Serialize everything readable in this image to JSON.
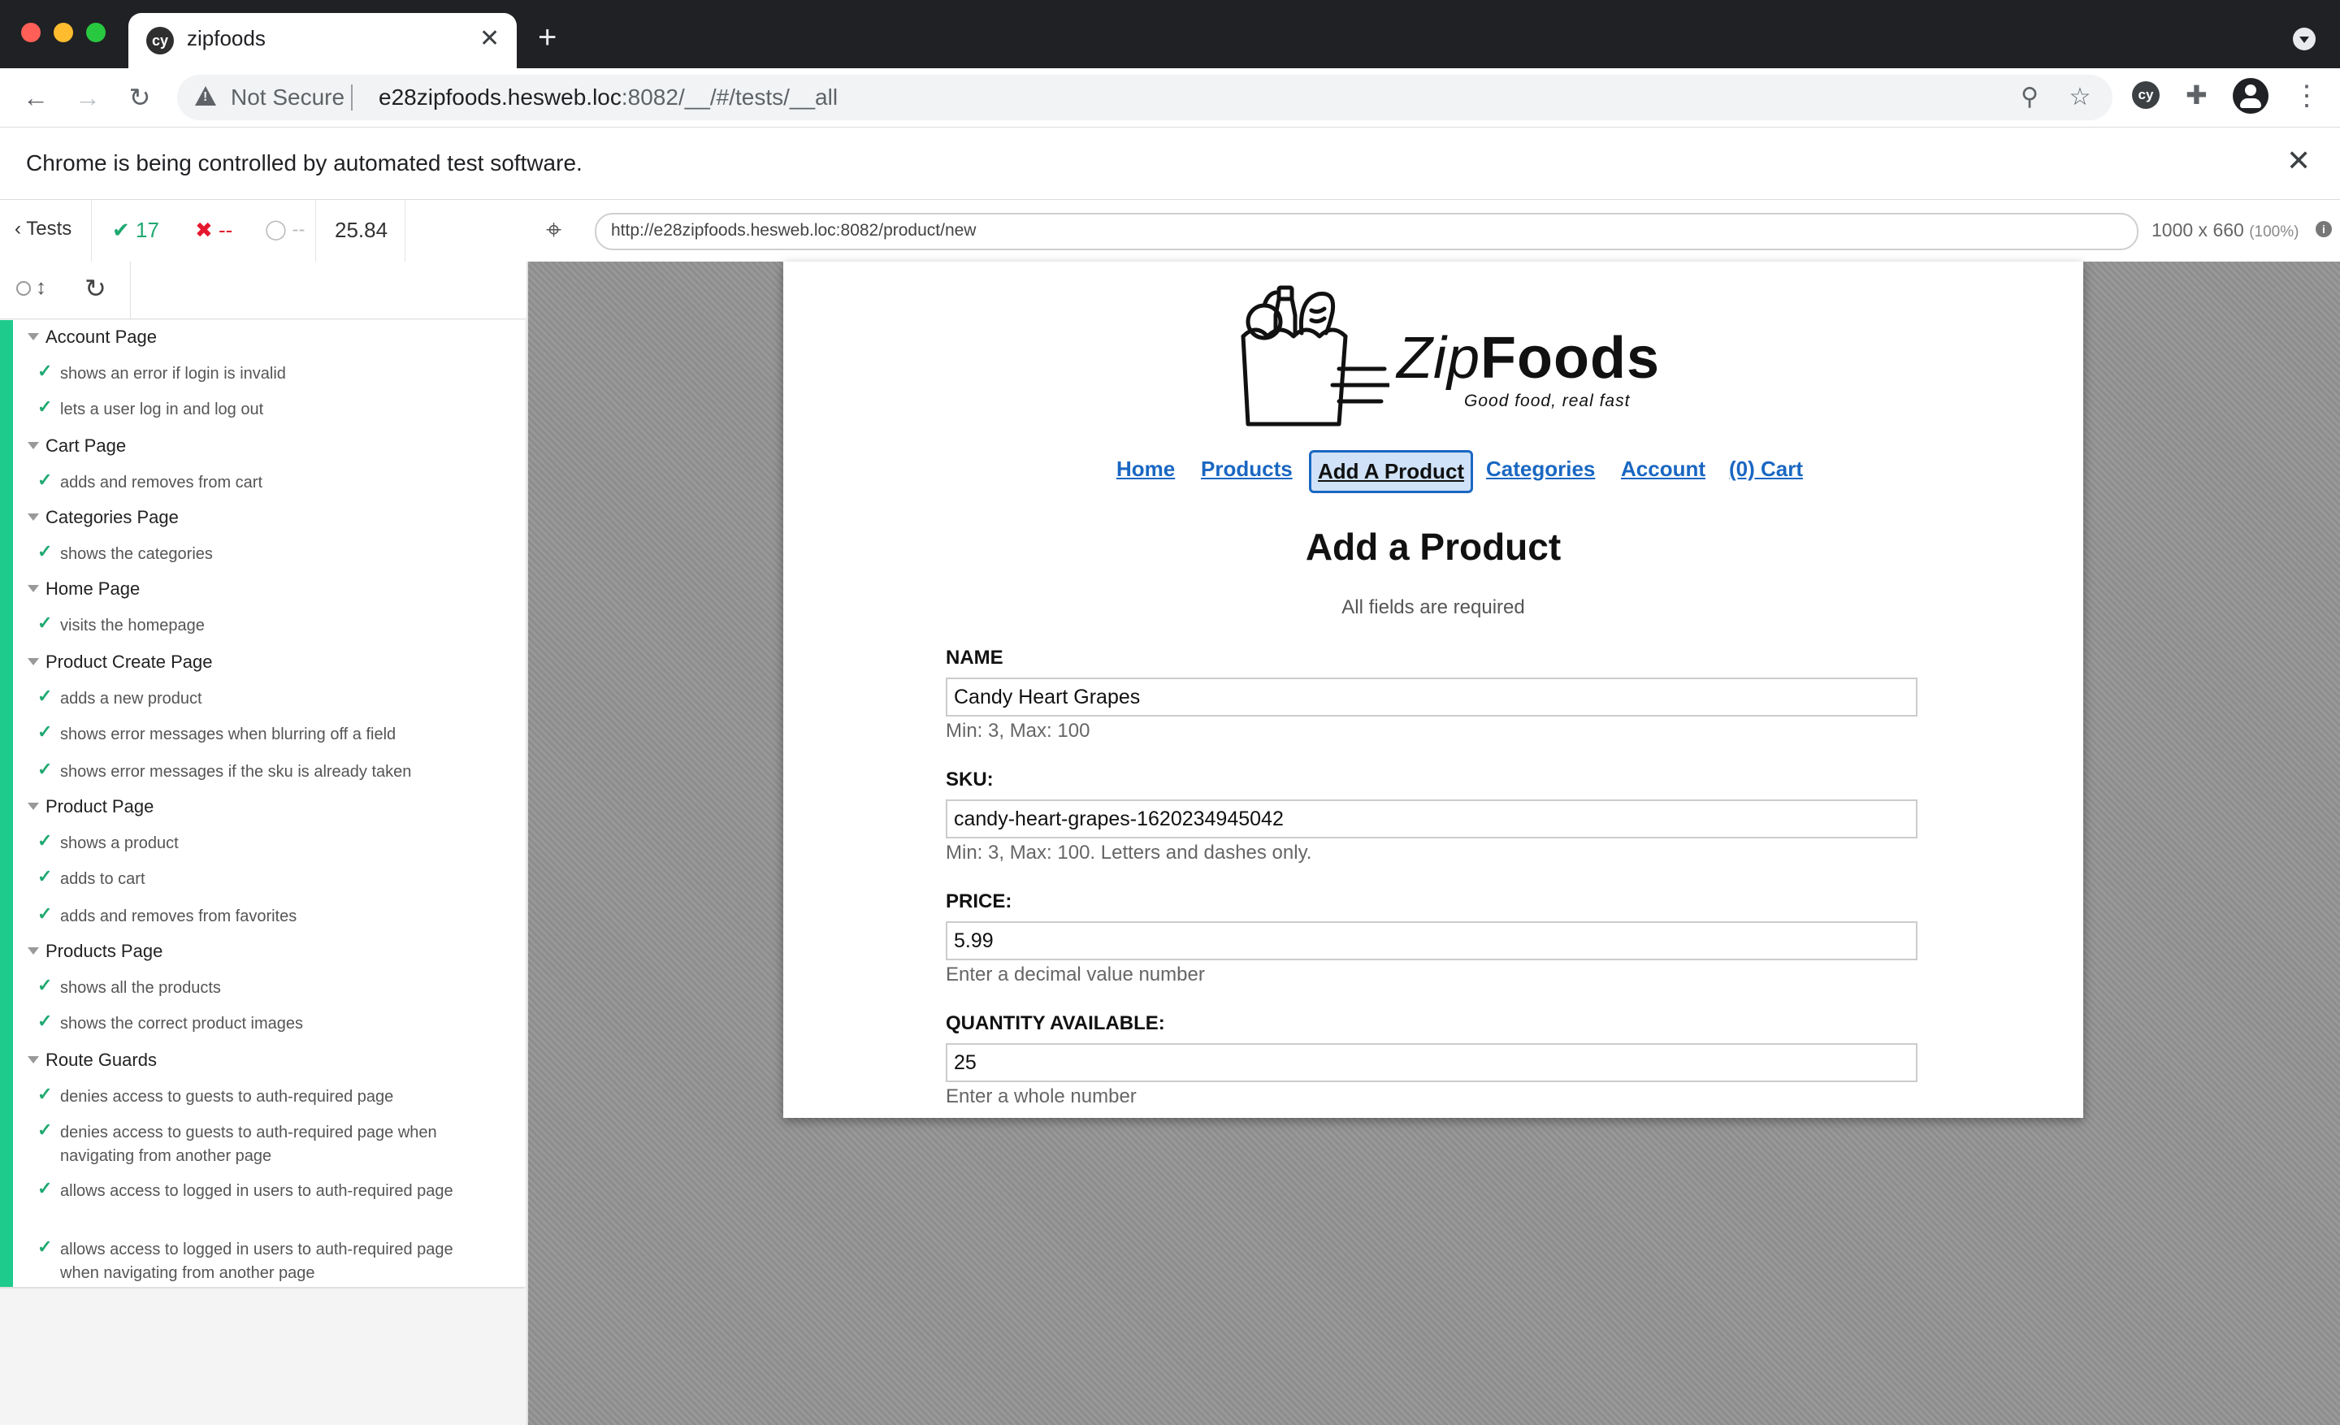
{
  "browser": {
    "tab_title": "zipfoods",
    "tab_favicon_text": "cy",
    "new_tab": "+",
    "not_secure": "Not Secure",
    "url_host": "e28zipfoods.hesweb.loc",
    "url_rest": ":8082/__/#/tests/__all",
    "extension_text": "cy",
    "infobar_text": "Chrome is being controlled by automated test software.",
    "infobar_close": "✕"
  },
  "cypress": {
    "tests_label": "Tests",
    "passed_count": "17",
    "failed_count": "--",
    "pending_count": "--",
    "duration": "25.84",
    "aut_url": "http://e28zipfoods.hesweb.loc:8082/product/new",
    "viewport_size": "1000 x 660",
    "viewport_scale": "(100%)",
    "info_icon": "i"
  },
  "reporter": {
    "suites": [
      {
        "title": "Account Page",
        "tests": [
          "shows an error if login is invalid",
          "lets a user log in and log out"
        ]
      },
      {
        "title": "Cart Page",
        "tests": [
          "adds and removes from cart"
        ]
      },
      {
        "title": "Categories Page",
        "tests": [
          "shows the categories"
        ]
      },
      {
        "title": "Home Page",
        "tests": [
          "visits the homepage"
        ]
      },
      {
        "title": "Product Create Page",
        "tests": [
          "adds a new product",
          "shows error messages when blurring off a field",
          "shows error messages if the sku is already taken"
        ]
      },
      {
        "title": "Product Page",
        "tests": [
          "shows a product",
          "adds to cart",
          "adds and removes from favorites"
        ]
      },
      {
        "title": "Products Page",
        "tests": [
          "shows all the products",
          "shows the correct product images"
        ]
      },
      {
        "title": "Route Guards",
        "tests": [
          "denies access to guests to auth-required page",
          "denies access to guests to auth-required page when navigating from another page",
          "allows access to logged in users to auth-required page",
          "allows access to logged in users to auth-required page when navigating from another page"
        ]
      }
    ]
  },
  "app": {
    "logo_zip": "Zip",
    "logo_foods": "Foods",
    "tagline": "Good food, real fast",
    "nav": {
      "home": "Home",
      "products": "Products",
      "add_product": "Add A Product",
      "categories": "Categories",
      "account": "Account",
      "cart": "(0) Cart"
    },
    "page_title": "Add a Product",
    "subtitle": "All fields are required",
    "fields": {
      "name": {
        "label": "NAME",
        "value": "Candy Heart Grapes",
        "hint": "Min: 3, Max: 100"
      },
      "sku": {
        "label": "SKU:",
        "value": "candy-heart-grapes-1620234945042",
        "hint": "Min: 3, Max: 100. Letters and dashes only."
      },
      "price": {
        "label": "PRICE:",
        "value": "5.99",
        "hint": "Enter a decimal value number"
      },
      "quantity": {
        "label": "QUANTITY AVAILABLE:",
        "value": "25",
        "hint": "Enter a whole number"
      }
    }
  },
  "colors": {
    "pass": "#1fa971",
    "fail": "#e5182f",
    "link": "#1a67c2",
    "pass_stripe": "#1fcb8c"
  }
}
